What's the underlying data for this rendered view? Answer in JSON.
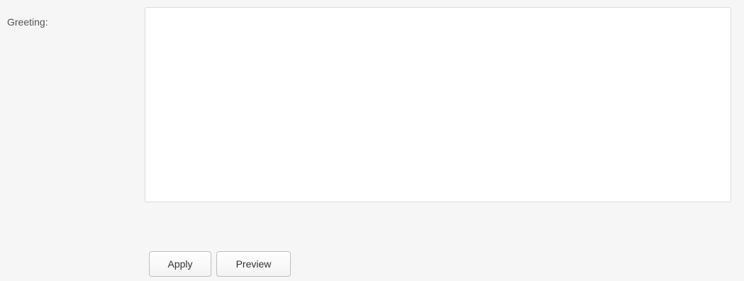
{
  "form": {
    "greeting_label": "Greeting:",
    "greeting_value": "",
    "greeting_placeholder": ""
  },
  "actions": {
    "apply_label": "Apply",
    "preview_label": "Preview"
  }
}
